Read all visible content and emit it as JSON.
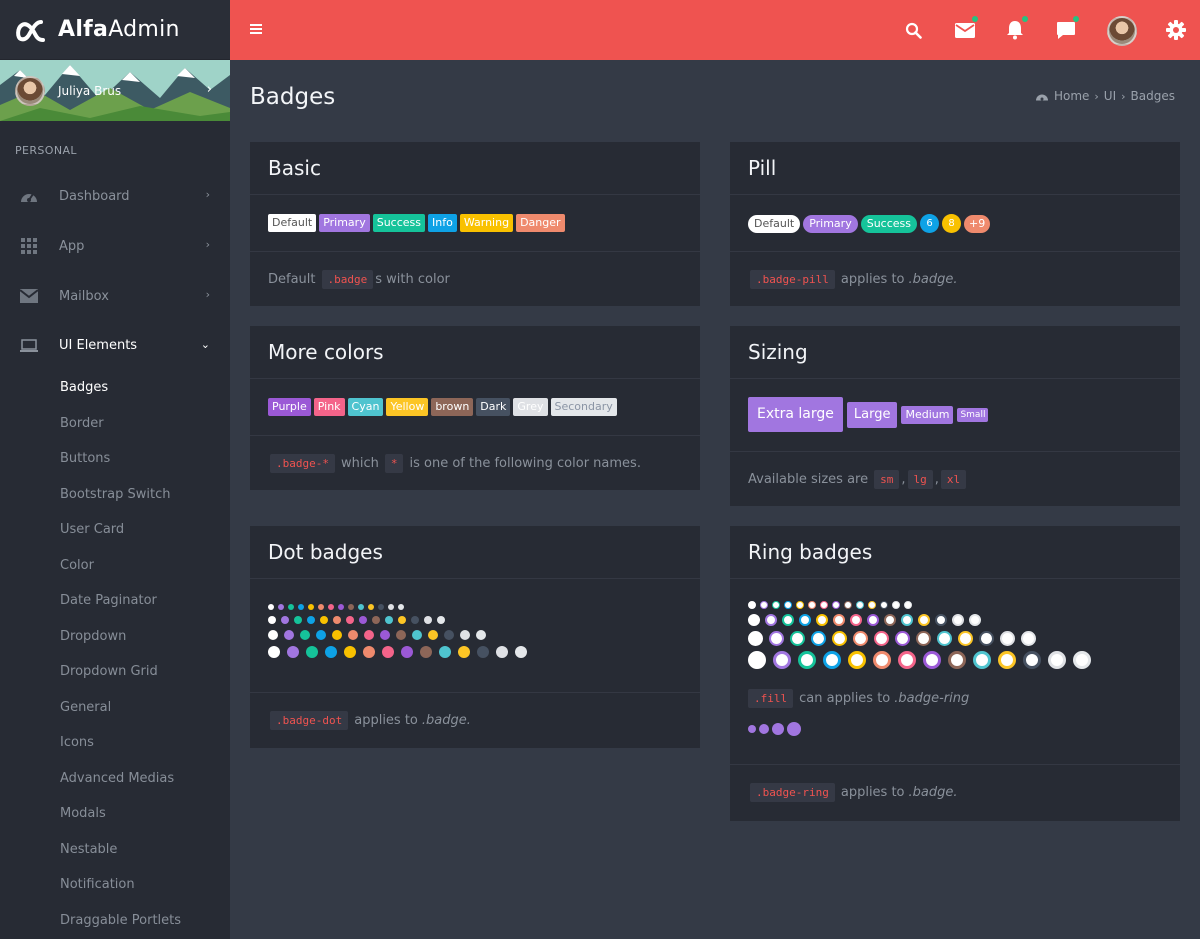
{
  "brand": {
    "bold": "Alfa",
    "light": "Admin"
  },
  "user": {
    "name": "Juliya Brus"
  },
  "sidebar": {
    "section": "PERSONAL",
    "items": [
      {
        "label": "Dashboard",
        "icon": "dashboard-icon"
      },
      {
        "label": "App",
        "icon": "grid-icon"
      },
      {
        "label": "Mailbox",
        "icon": "mail-icon"
      },
      {
        "label": "UI Elements",
        "icon": "laptop-icon"
      }
    ],
    "sub": [
      "Badges",
      "Border",
      "Buttons",
      "Bootstrap Switch",
      "User Card",
      "Color",
      "Date Paginator",
      "Dropdown",
      "Dropdown Grid",
      "General",
      "Icons",
      "Advanced Medias",
      "Modals",
      "Nestable",
      "Notification",
      "Draggable Portlets"
    ]
  },
  "page": {
    "title": "Badges"
  },
  "breadcrumb": {
    "home": "Home",
    "ui": "UI",
    "current": "Badges"
  },
  "colors": {
    "primary": "#a176e0",
    "success": "#15c39a",
    "info": "#0ea2e6",
    "warning": "#f9c100",
    "danger": "#ef8a6d",
    "topbar": "#ef5350"
  },
  "basic": {
    "title": "Basic",
    "badges": [
      "Default",
      "Primary",
      "Success",
      "Info",
      "Warning",
      "Danger"
    ],
    "code": ".badge",
    "pre": "Default",
    "post": "s with color"
  },
  "pill": {
    "title": "Pill",
    "badges": [
      "Default",
      "Primary",
      "Success"
    ],
    "nums": [
      "6",
      "8",
      "+9"
    ],
    "code": ".badge-pill",
    "text": "applies to",
    "target": ".badge."
  },
  "more": {
    "title": "More colors",
    "badges": [
      "Purple",
      "Pink",
      "Cyan",
      "Yellow",
      "brown",
      "Dark",
      "Grey",
      "Secondary"
    ],
    "code1": ".badge-*",
    "mid": "which",
    "code2": "*",
    "text": "is one of the following color names."
  },
  "sizing": {
    "title": "Sizing",
    "badges": [
      "Extra large",
      "Large",
      "Medium",
      "Small"
    ],
    "text": "Available sizes are",
    "c1": "sm",
    "c2": "lg",
    "c3": "xl"
  },
  "dot": {
    "title": "Dot badges",
    "code": ".badge-dot",
    "text": "applies to",
    "target": ".badge."
  },
  "ring": {
    "title": "Ring badges",
    "code1": ".fill",
    "text1": "can applies to",
    "target1": ".badge-ring",
    "code2": ".badge-ring",
    "text2": "applies to",
    "target2": ".badge."
  }
}
